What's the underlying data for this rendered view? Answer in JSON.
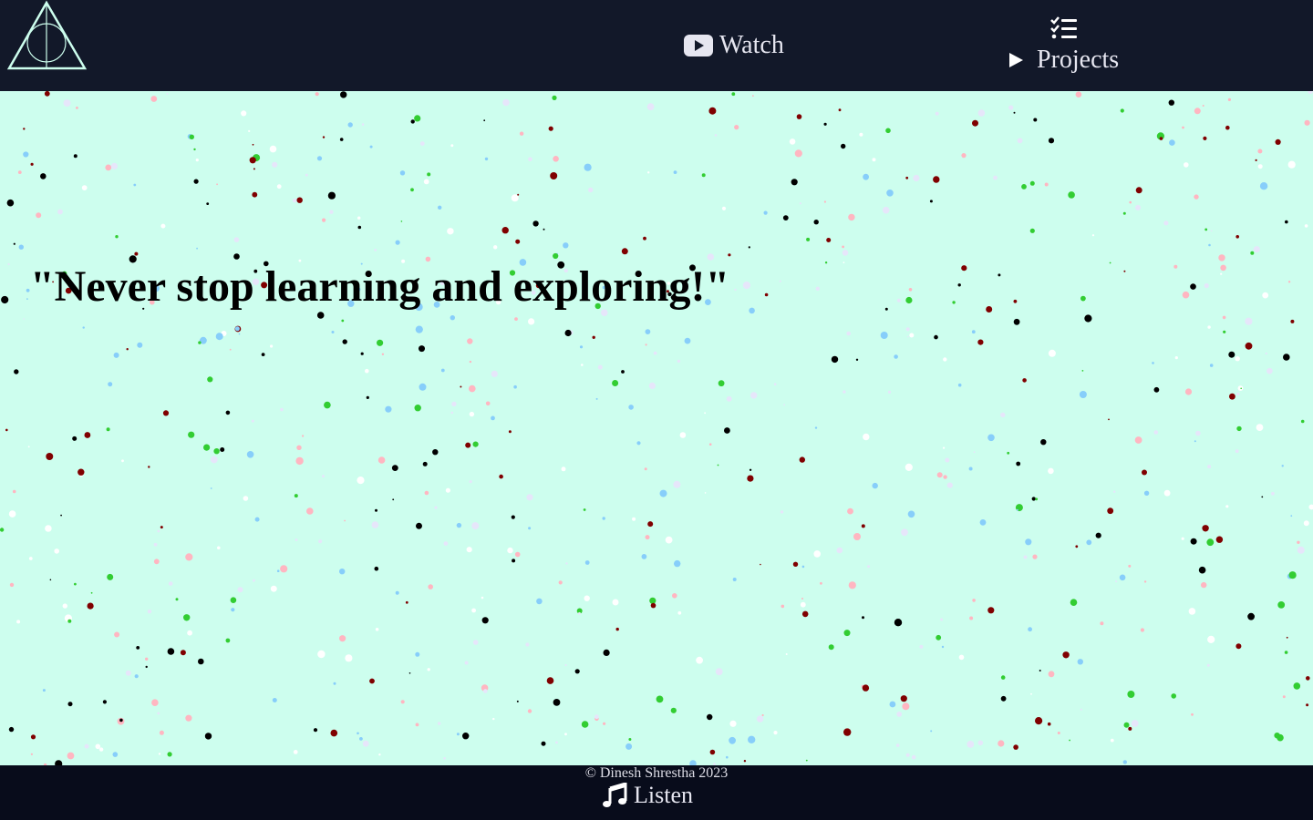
{
  "header": {
    "logo_icon": "deathly-hallows-icon",
    "watch_label": "Watch",
    "watch_icon": "youtube-icon",
    "projects_icon": "checklist-icon",
    "projects_label": "Projects",
    "projects_caret_icon": "triangle-right-icon"
  },
  "main": {
    "quote": "\"Never stop learning and exploring!\"",
    "background_color": "#cdfeee",
    "dot_colors": [
      "#000000",
      "#800000",
      "#32cd32",
      "#87cefa",
      "#ffb6c1",
      "#ffffff",
      "#e6e6fa"
    ]
  },
  "footer": {
    "copyright": "© Dinesh Shrestha 2023",
    "listen_label": "Listen",
    "listen_icon": "music-note-icon"
  },
  "colors": {
    "header_bg": "#121829",
    "footer_bg": "#080c1b",
    "text_light": "#e6e6f0"
  }
}
